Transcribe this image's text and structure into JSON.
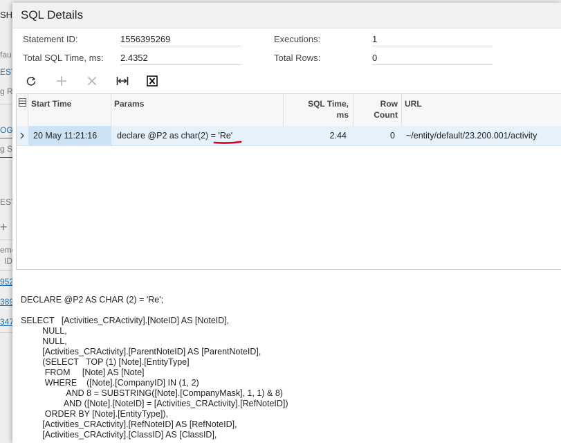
{
  "background": {
    "items": [
      "SH",
      "fau",
      "EST",
      "g R",
      "OGO",
      "g S",
      "EST",
      "+",
      "eme",
      "ID",
      "952",
      "389",
      "347"
    ]
  },
  "dialog": {
    "title": "SQL Details",
    "fields": {
      "statement_id_label": "Statement ID:",
      "statement_id_value": "1556395269",
      "total_sql_time_label": "Total SQL Time, ms:",
      "total_sql_time_value": "2.4352",
      "executions_label": "Executions:",
      "executions_value": "1",
      "total_rows_label": "Total Rows:",
      "total_rows_value": "0"
    },
    "toolbar": {
      "refresh_icon": "refresh-icon",
      "add_icon": "plus-icon",
      "delete_icon": "close-icon",
      "fit_icon": "fit-columns-icon",
      "excel_icon": "excel-export-icon"
    },
    "grid": {
      "columns": {
        "start_time": "Start Time",
        "params": "Params",
        "sql_time_1": "SQL Time,",
        "sql_time_2": "ms",
        "row_count_1": "Row",
        "row_count_2": "Count",
        "url": "URL"
      },
      "rows": [
        {
          "start_time": "20 May 11:21:16",
          "params": "declare @P2 as char(2) = 'Re'",
          "sql_time": "2.44",
          "row_count": "0",
          "url": "~/entity/default/23.200.001/activity"
        }
      ]
    },
    "sql_query": "DECLARE @P2 AS CHAR (2) = 'Re';\n\nSELECT   [Activities_CRActivity].[NoteID] AS [NoteID],\n         NULL,\n         NULL,\n         [Activities_CRActivity].[ParentNoteID] AS [ParentNoteID],\n         (SELECT   TOP (1) [Note].[EntityType]\n          FROM     [Note] AS [Note]\n          WHERE    ([Note].[CompanyID] IN (1, 2)\n                   AND 8 = SUBSTRING([Note].[CompanyMask], 1, 1) & 8)\n                  AND ([Note].[NoteID] = [Activities_CRActivity].[RefNoteID])\n          ORDER BY [Note].[EntityType]),\n         [Activities_CRActivity].[RefNoteID] AS [RefNoteID],\n         [Activities_CRActivity].[ClassID] AS [ClassID],"
  }
}
